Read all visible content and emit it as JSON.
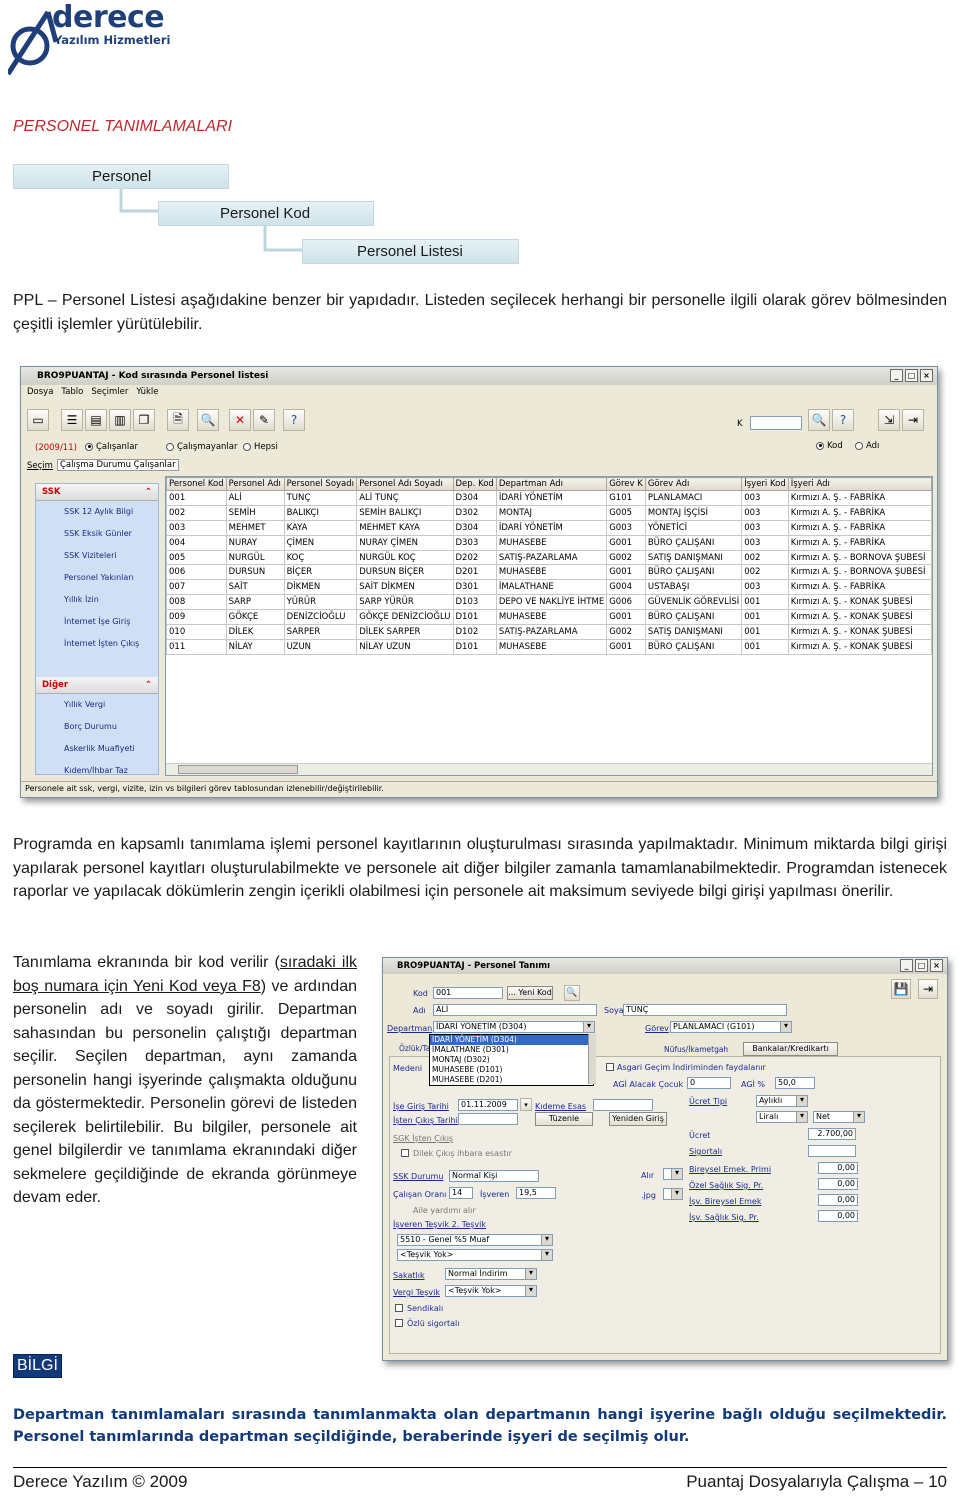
{
  "header": {
    "logo_word": "derece",
    "logo_sub": "Yazılım Hizmetleri",
    "section_title": "PERSONEL TANIMLAMALARI"
  },
  "breadcrumb": [
    "Personel",
    "Personel Kod",
    "Personel Listesi"
  ],
  "intro_text": "PPL – Personel Listesi aşağıdakine benzer bir yapıdadır. Listeden seçilecek herhangi bir personelle ilgili olarak görev bölmesinden çeşitli işlemler yürütülebilir.",
  "list_window": {
    "title": "BRO9PUANTAJ - Kod sırasında Personel listesi",
    "menu": [
      "Dosya",
      "Tablo",
      "Seçimler",
      "Yükle"
    ],
    "period": "(2009/11)",
    "radios": [
      {
        "label": "Çalışanlar",
        "checked": true
      },
      {
        "label": "Çalışmayanlar",
        "checked": false
      },
      {
        "label": "Hepsi",
        "checked": false
      }
    ],
    "sort_radios": [
      {
        "label": "Kod",
        "checked": true
      },
      {
        "label": "Adı",
        "checked": false
      }
    ],
    "search_label": "K",
    "selection_label": "Seçim",
    "selection_value": "Çalışma Durumu Çalışanlar",
    "sidebar_groups": [
      {
        "title": "SSK",
        "items": [
          "SSK 12 Aylık Bilgi",
          "SSK Eksik Günler",
          "SSK Vizite​leri",
          "Personel Yakınları",
          "Yıllık İzin",
          "İnternet İşe Giriş",
          "İnternet İşten Çıkış"
        ]
      },
      {
        "title": "Diğer",
        "items": [
          "Yıllık Vergi",
          "Borç Durumu",
          "Askerlik Muafiyeti",
          "Kıdem/İhbar Taz"
        ]
      }
    ],
    "columns": [
      "Personel Kod",
      "Personel Adı",
      "Personel Soyadı",
      "Personel Adı Soyadı",
      "Dep. Kod",
      "Departman Adı",
      "Görev K",
      "Görev Adı",
      "İşyeri Kod",
      "İşyeri Adı"
    ],
    "rows": [
      [
        "001",
        "ALİ",
        "TUNÇ",
        "ALİ TUNÇ",
        "D304",
        "İDARİ YÖNETİM",
        "G101",
        "PLANLAMACI",
        "003",
        "Kırmızı A. Ş. - FABRİKA"
      ],
      [
        "002",
        "SEMİH",
        "BALIKÇI",
        "SEMİH BALIKÇI",
        "D302",
        "MONTAJ",
        "G005",
        "MONTAJ İŞÇİSİ",
        "003",
        "Kırmızı A. Ş. - FABRİKA"
      ],
      [
        "003",
        "MEHMET",
        "KAYA",
        "MEHMET KAYA",
        "D304",
        "İDARİ YÖNETİM",
        "G003",
        "YÖNETİCİ",
        "003",
        "Kırmızı A. Ş. - FABRİKA"
      ],
      [
        "004",
        "NURAY",
        "ÇİMEN",
        "NURAY ÇİMEN",
        "D303",
        "MUHASEBE",
        "G001",
        "BÜRO ÇALIŞANI",
        "003",
        "Kırmızı A. Ş. - FABRİKA"
      ],
      [
        "005",
        "NURGÜL",
        "KOÇ",
        "NURGÜL KOÇ",
        "D202",
        "SATIŞ-PAZARLAMA",
        "G002",
        "SATIŞ DANIŞMANI",
        "002",
        "Kırmızı A. Ş. - BORNOVA ŞUBESİ"
      ],
      [
        "006",
        "DURSUN",
        "BİÇER",
        "DURSUN BİÇER",
        "D201",
        "MUHASEBE",
        "G001",
        "BÜRO ÇALIŞANI",
        "002",
        "Kırmızı A. Ş. - BORNOVA ŞUBESİ"
      ],
      [
        "007",
        "SAİT",
        "DİKMEN",
        "SAİT DİKMEN",
        "D301",
        "İMALATHANE",
        "G004",
        "USTABAŞI",
        "003",
        "Kırmızı A. Ş. - FABRİKA"
      ],
      [
        "008",
        "SARP",
        "YÜRÜR",
        "SARP YÜRÜR",
        "D103",
        "DEPO VE NAKLİYE İHTME",
        "G006",
        "GÜVENLİK GÖREVLİSİ",
        "001",
        "Kırmızı A. Ş. - KONAK ŞUBESİ"
      ],
      [
        "009",
        "GÖKÇE",
        "DENİZCİOĞLU",
        "GÖKÇE DENİZCİOĞLU",
        "D101",
        "MUHASEBE",
        "G001",
        "BÜRO ÇALIŞANI",
        "001",
        "Kırmızı A. Ş. - KONAK ŞUBESİ"
      ],
      [
        "010",
        "DİLEK",
        "SARPER",
        "DİLEK SARPER",
        "D102",
        "SATIŞ-PAZARLAMA",
        "G002",
        "SATIŞ DANIŞMANI",
        "001",
        "Kırmızı A. Ş. - KONAK ŞUBESİ"
      ],
      [
        "011",
        "NİLAY",
        "UZUN",
        "NİLAY UZUN",
        "D101",
        "MUHASEBE",
        "G001",
        "BÜRO ÇALIŞANI",
        "001",
        "Kırmızı A. Ş. - KONAK ŞUBESİ"
      ]
    ],
    "status": "Personele ait ssk, vergi, vizite, izin vs bilgileri görev tablosundan izlenebilir/değiştirilebilir."
  },
  "para2": "Programda en kapsamlı tanımlama işlemi personel kayıtlarının oluşturulması sırasında yapılmaktadır. Minimum miktarda bilgi girişi yapılarak personel kayıtları oluşturulabilmekte ve personele ait diğer bilgiler zamanla tamamlanabilmektedir. Programdan istenecek raporlar ve yapılacak dökümlerin zengin içerikli olabilmesi için personele ait maksimum seviyede bilgi girişi yapılması önerilir.",
  "para3": {
    "before": "Tanımlama ekranında bir kod verilir (",
    "link": "sıradaki ilk boş numara için Yeni Kod veya F8",
    "after": ") ve ardından personelin adı ve soyadı girilir. Departman sahasından bu personelin çalıştığı departman seçilir. Seçilen departman, aynı zamanda personelin hangi işyerinde çalışmakta olduğunu da göstermektedir. Personelin görevi de listeden seçilerek belirtilebilir. Bu bilgiler, personele ait genel bilgilerdir ve tanımlama ekranındaki diğer sekmelere geçildiğinde de ekranda görünmeye devam eder."
  },
  "form_window": {
    "title": "BRO9PUANTAJ - Personel Tanımı",
    "kod_label": "Kod",
    "kod_value": "001",
    "yeni_kod": "... Yeni Kod",
    "adi_label": "Adı",
    "adi_value": "ALİ",
    "soyadi_label": "Soyadı",
    "soyadi_value": "TUNÇ",
    "departman_label": "Departman",
    "departman_value": "İDARİ YÖNETİM (D304)",
    "gorev_label": "Görev",
    "gorev_value": "PLANLAMACI (G101)",
    "dept_options": [
      "İDARİ YÖNETİM (D304)",
      "İMALATHANE (D301)",
      "MONTAJ (D302)",
      "MUHASEBE (D101)",
      "MUHASEBE (D201)"
    ],
    "tabs": [
      "Özlük/Tat",
      "Nüfus/İkametgah"
    ],
    "medeni_label": "Medeni",
    "gelir_label": "Asgari Geçim İndiriminden faydalanır",
    "bankalar_label": "Bankalar/Kredikartı",
    "agi_label": "AGİ Alacak Çocuk",
    "agi_value": "0",
    "agi_pct_label": "AGİ %",
    "agi_pct_value": "50,0",
    "ise_giris_label": "İşe Giriş Tarihi",
    "ise_giris_value": "01.11.2009",
    "kidem_label": "Kıdeme Esas",
    "isten_cikis_label": "İşten Çıkış Tarihi",
    "tuzenle": "Tüzenle",
    "yeniden_giris": "Yeniden Giriş",
    "sgk_label": "SGK İşten Çıkış",
    "dilek_label": "Dilek Çıkış ihbara esastır",
    "ucret_tipi_label": "Ücret Tipi",
    "ucret_tipi_value": "Aylıklı",
    "liralı": "Liralı",
    "net": "Net",
    "ucret_label": "Ücret",
    "ucret_value": "2.700,00",
    "sigortali_label": "Sigortalı",
    "ssk_durum_label": "SSK Durumu",
    "ssk_durum_value": "Normal Kişi",
    "alır": "Alır",
    "calisan_orani_label": "Çalışan Oranı",
    "calisan_orani_value": "14",
    "isveren_label": "İşveren",
    "isveren_value": "19,5",
    "jpg_label": ".jpg",
    "bes_label": "Bireysel Emek. Primi",
    "bes_value": "0,00",
    "ozel_sig_label": "Özel Sağlık Sig. Pr.",
    "ozel_sig_value": "0,00",
    "isv_bes_label": "İşv. Bireysel Emek",
    "isv_bes_value": "0,00",
    "isv_saglik_label": "İşv. Sağlık Sig. Pr.",
    "isv_saglik_value": "0,00",
    "tesvik_label": "İşveren Teşvik 2. Teşvik",
    "tesvik_value": "5510 - Genel %5 Muaf",
    "tesvik_yok": "<Teşvik Yok>",
    "sakatlik_label": "Sakatlık",
    "sakatlik_value": "Normal İndirim",
    "vergi_tesvik_label": "Vergi Teşvik",
    "vergi_tesvik_value": "<Teşvik Yok>",
    "sendikali": "Sendikalı",
    "ozlu_sig": "Özlü sigortalı",
    "aile_yardimi": "Aile yardımı alır"
  },
  "bilgi_label": "BİLGİ",
  "bilgi_note": "Departman tanımlamaları sırasında tanımlanmakta olan departmanın hangi işyerine bağlı olduğu seçilmektedir. Personel tanımlarında departman seçildiğinde, beraberinde işyeri de seçilmiş olur.",
  "footer": {
    "left": "Derece Yazılım © 2009",
    "right": "Puantaj Dosyalarıyla Çalışma – 10"
  }
}
